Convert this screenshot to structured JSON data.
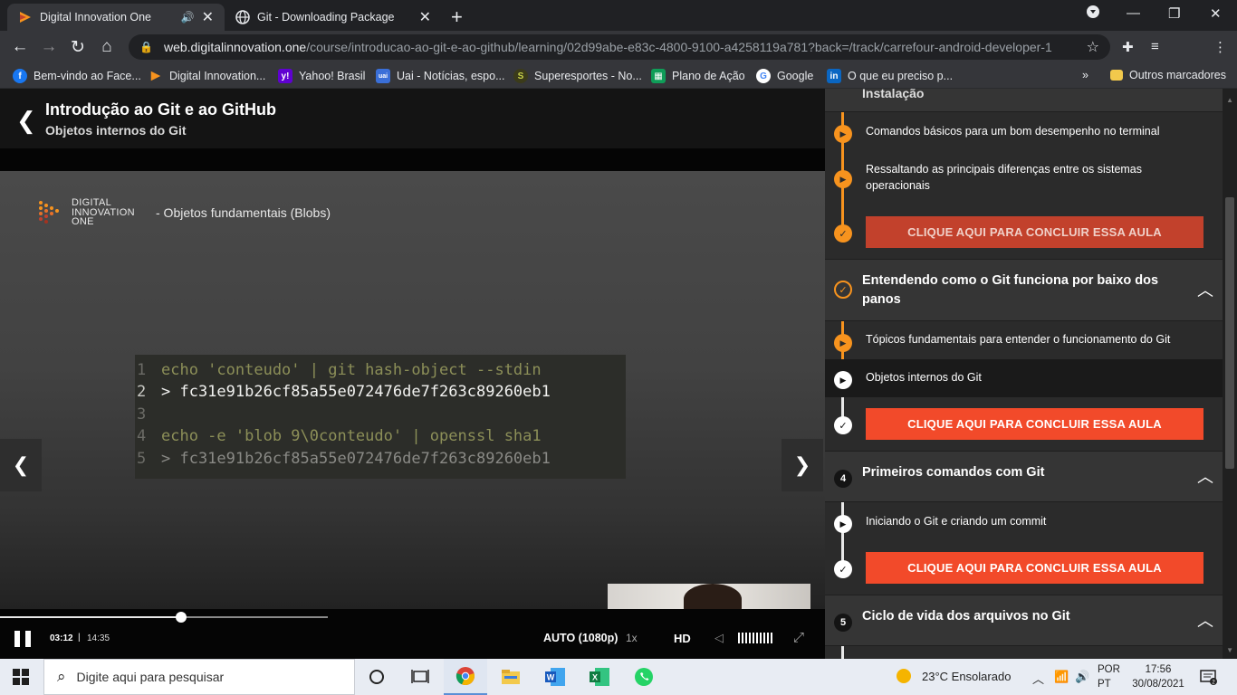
{
  "browser": {
    "tabs": [
      {
        "title": "Digital Innovation One",
        "active": true,
        "audio": true
      },
      {
        "title": "Git - Downloading Package",
        "active": false
      }
    ],
    "url_host": "web.digitalinnovation.one",
    "url_path": "/course/introducao-ao-git-e-ao-github/learning/02d99abe-e83c-4800-9100-a4258119a781?back=/track/carrefour-android-developer-1",
    "bookmarks": [
      {
        "label": "Bem-vindo ao Face...",
        "icon": "facebook-icon",
        "color": "#1877f2"
      },
      {
        "label": "Digital Innovation...",
        "icon": "dio-icon",
        "color": "#f7931e"
      },
      {
        "label": "Yahoo! Brasil",
        "icon": "yahoo-icon",
        "color": "#5f01d1"
      },
      {
        "label": "Uai - Notícias, espo...",
        "icon": "uai-icon",
        "color": "#3a6fd8"
      },
      {
        "label": "Superesportes - No...",
        "icon": "superesportes-icon",
        "color": "#7a8a1e"
      },
      {
        "label": "Plano de Ação",
        "icon": "sheets-icon",
        "color": "#0f9d58"
      },
      {
        "label": "Google",
        "icon": "google-icon",
        "color": "#4285f4"
      },
      {
        "label": "O que eu preciso p...",
        "icon": "linkedin-icon",
        "color": "#0a66c2"
      }
    ],
    "other_bookmarks": "Outros marcadores"
  },
  "course": {
    "title": "Introdução ao Git e ao GitHub",
    "lesson": "Objetos internos do Git"
  },
  "video": {
    "brand_lines": [
      "DIGITAL",
      "INNOVATION",
      "ONE"
    ],
    "slide_subtitle": "- Objetos fundamentais (Blobs)",
    "code_lines": [
      {
        "n": "1",
        "text": "echo 'conteudo' | git hash-object --stdin"
      },
      {
        "n": "2",
        "text": "> fc31e91b26cf85a55e072476de7f263c89260eb1"
      },
      {
        "n": "3",
        "text": ""
      },
      {
        "n": "4",
        "text": "echo -e 'blob 9\\0conteudo' | openssl sha1"
      },
      {
        "n": "5",
        "text": "> fc31e91b26cf85a55e072476de7f263c89260eb1"
      }
    ],
    "current_time": "03:12",
    "separator": "|",
    "duration": "14:35",
    "progress_fraction": 0.22,
    "quality": "AUTO (1080p)",
    "speed": "1x",
    "hd_label": "HD"
  },
  "sidebar": {
    "partial_section_title": "Instalação",
    "sections": [
      {
        "badge": "",
        "title": "Entendendo como o Git funciona por baixo dos panos",
        "items": [
          {
            "label": "Tópicos fundamentais para entender o funcionamento do Git"
          },
          {
            "label": "Objetos internos do Git"
          }
        ]
      },
      {
        "badge": "4",
        "title": "Primeiros comandos com Git",
        "items": [
          {
            "label": "Iniciando o Git e criando um commit"
          }
        ]
      },
      {
        "badge": "5",
        "title": "Ciclo de vida dos arquivos no Git",
        "items": []
      }
    ],
    "top_items": [
      {
        "label": "Comandos básicos para um bom desempenho no terminal"
      },
      {
        "label": "Ressaltando as principais diferenças entre os sistemas operacionais"
      }
    ],
    "cta_label": "CLIQUE AQUI PARA CONCLUIR ESSA AULA"
  },
  "taskbar": {
    "search_placeholder": "Digite aqui para pesquisar",
    "weather": "23°C  Ensolarado",
    "lang_line1": "POR",
    "lang_line2": "PT",
    "time": "17:56",
    "date": "30/08/2021"
  }
}
